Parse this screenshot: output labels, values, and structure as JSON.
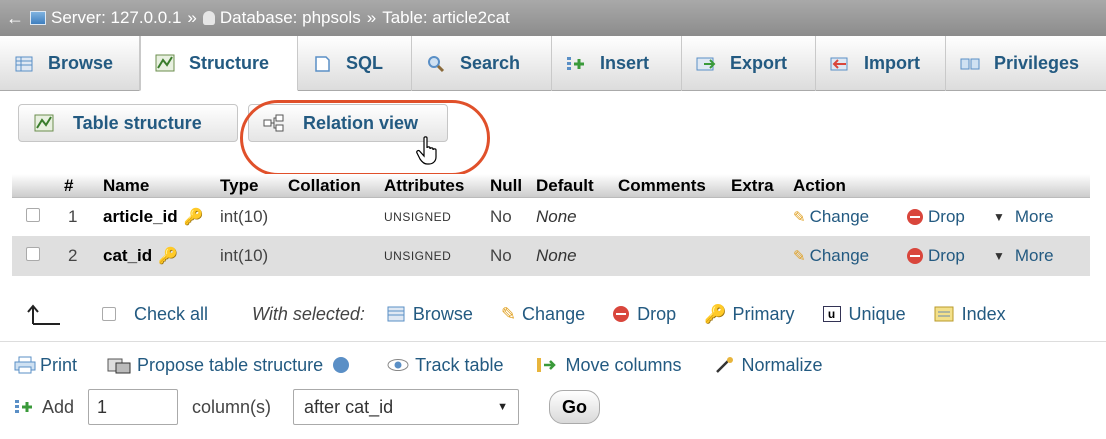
{
  "breadcrumb": {
    "back": "←",
    "server": "Server: 127.0.0.1",
    "database": "Database: phpsols",
    "table": "Table: article2cat",
    "separator": "»"
  },
  "tabs": [
    {
      "label": "Browse",
      "icon": "browse-icon"
    },
    {
      "label": "Structure",
      "icon": "structure-icon",
      "active": true
    },
    {
      "label": "SQL",
      "icon": "sql-icon"
    },
    {
      "label": "Search",
      "icon": "search-icon"
    },
    {
      "label": "Insert",
      "icon": "insert-icon"
    },
    {
      "label": "Export",
      "icon": "export-icon"
    },
    {
      "label": "Import",
      "icon": "import-icon"
    },
    {
      "label": "Privileges",
      "icon": "privileges-icon"
    }
  ],
  "subtabs": {
    "table_structure": "Table structure",
    "relation_view": "Relation view"
  },
  "table": {
    "headers": [
      "#",
      "Name",
      "Type",
      "Collation",
      "Attributes",
      "Null",
      "Default",
      "Comments",
      "Extra",
      "Action"
    ],
    "rows": [
      {
        "num": "1",
        "name": "article_id",
        "type": "int(10)",
        "attributes": "UNSIGNED",
        "null": "No",
        "default": "None"
      },
      {
        "num": "2",
        "name": "cat_id",
        "type": "int(10)",
        "attributes": "UNSIGNED",
        "null": "No",
        "default": "None"
      }
    ],
    "actions": {
      "change": "Change",
      "drop": "Drop",
      "more": "More"
    }
  },
  "with_selected": {
    "check_all": "Check all",
    "label": "With selected:",
    "browse": "Browse",
    "change": "Change",
    "drop": "Drop",
    "primary": "Primary",
    "unique": "Unique",
    "index": "Index"
  },
  "tools": {
    "print": "Print",
    "propose": "Propose table structure",
    "track": "Track table",
    "move": "Move columns",
    "normalize": "Normalize"
  },
  "add_column": {
    "add": "Add",
    "count": "1",
    "columns_label": "column(s)",
    "position": "after cat_id",
    "go": "Go"
  },
  "colors": {
    "link": "#235a81",
    "highlight": "#e0502a",
    "drop": "#d9463c"
  }
}
